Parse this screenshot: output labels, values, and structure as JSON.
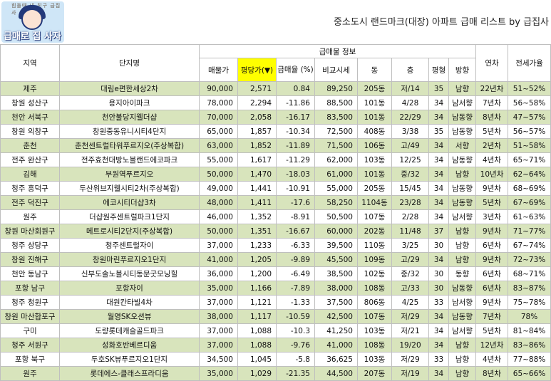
{
  "logo": {
    "arc_text": "힘들때 내 친구 급집사",
    "word": "급매로 집 사자"
  },
  "title": "중소도시 랜드마크(대장) 아파트 급매 리스트 by 급집사",
  "table": {
    "headers": {
      "region": "지역",
      "complex": "단지명",
      "group": "급매물 정보",
      "price": "매물가",
      "per_pyeong": "평당가(▼)",
      "discount": "급매율 (%)",
      "compare": "비교시세",
      "dong": "동",
      "floor": "층",
      "pyeong": "평형",
      "direction": "방향",
      "age": "연차",
      "jeonse": "전세가율"
    },
    "rows": [
      {
        "region": "제주",
        "complex": "대림e편한세상2차",
        "price": "90,000",
        "per": "2,571",
        "disc": "0.84",
        "cmp": "89,250",
        "dong": "205동",
        "floor": "저/14",
        "pyeong": "35",
        "dir": "남향",
        "age": "22년차",
        "jeonse": "51~52%"
      },
      {
        "region": "창원 성산구",
        "complex": "용지아이파크",
        "price": "78,000",
        "per": "2,294",
        "disc": "-11.86",
        "cmp": "88,500",
        "dong": "101동",
        "floor": "4/28",
        "pyeong": "34",
        "dir": "남서향",
        "age": "7년차",
        "jeonse": "56~58%"
      },
      {
        "region": "천안 서북구",
        "complex": "천안불당지웰더샵",
        "price": "70,000",
        "per": "2,058",
        "disc": "-16.17",
        "cmp": "83,500",
        "dong": "101동",
        "floor": "22/29",
        "pyeong": "34",
        "dir": "남동향",
        "age": "8년차",
        "jeonse": "47~57%"
      },
      {
        "region": "창원 의창구",
        "complex": "창원중동유니시티4단지",
        "price": "65,000",
        "per": "1,857",
        "disc": "-10.34",
        "cmp": "72,500",
        "dong": "408동",
        "floor": "3/38",
        "pyeong": "35",
        "dir": "남동향",
        "age": "5년차",
        "jeonse": "56~57%"
      },
      {
        "region": "춘천",
        "complex": "춘천센트럴타워푸르지오(주상복합)",
        "price": "63,000",
        "per": "1,852",
        "disc": "-11.89",
        "cmp": "71,500",
        "dong": "106동",
        "floor": "고/49",
        "pyeong": "34",
        "dir": "서향",
        "age": "2년차",
        "jeonse": "51~58%"
      },
      {
        "region": "전주 완산구",
        "complex": "전주효천대방노블랜드에코파크",
        "price": "55,000",
        "per": "1,617",
        "disc": "-11.29",
        "cmp": "62,000",
        "dong": "103동",
        "floor": "12/25",
        "pyeong": "34",
        "dir": "남동향",
        "age": "4년차",
        "jeonse": "65~71%"
      },
      {
        "region": "김해",
        "complex": "부원역푸르지오",
        "price": "50,000",
        "per": "1,470",
        "disc": "-18.03",
        "cmp": "61,000",
        "dong": "101동",
        "floor": "중/32",
        "pyeong": "34",
        "dir": "남향",
        "age": "10년차",
        "jeonse": "62~64%"
      },
      {
        "region": "청주 흥덕구",
        "complex": "두산위브지웰시티2차(주상복합)",
        "price": "49,000",
        "per": "1,441",
        "disc": "-10.91",
        "cmp": "55,000",
        "dong": "205동",
        "floor": "15/45",
        "pyeong": "34",
        "dir": "남동향",
        "age": "9년차",
        "jeonse": "68~69%"
      },
      {
        "region": "전주 덕진구",
        "complex": "에코시티더샵3차",
        "price": "48,000",
        "per": "1,411",
        "disc": "-17.6",
        "cmp": "58,250",
        "dong": "1104동",
        "floor": "23/28",
        "pyeong": "34",
        "dir": "남동향",
        "age": "5년차",
        "jeonse": "67~69%"
      },
      {
        "region": "원주",
        "complex": "더샵원주센트럴파크1단지",
        "price": "46,000",
        "per": "1,352",
        "disc": "-8.91",
        "cmp": "50,500",
        "dong": "107동",
        "floor": "2/28",
        "pyeong": "34",
        "dir": "남서향",
        "age": "3년차",
        "jeonse": "61~63%"
      },
      {
        "region": "창원 마산회원구",
        "complex": "메트로시티2단지(주상복합)",
        "price": "50,000",
        "per": "1,351",
        "disc": "-16.67",
        "cmp": "60,000",
        "dong": "202동",
        "floor": "11/48",
        "pyeong": "37",
        "dir": "남향",
        "age": "9년차",
        "jeonse": "71~77%"
      },
      {
        "region": "청주 상당구",
        "complex": "청주센트럴자이",
        "price": "37,000",
        "per": "1,233",
        "disc": "-6.33",
        "cmp": "39,500",
        "dong": "110동",
        "floor": "3/25",
        "pyeong": "30",
        "dir": "남향",
        "age": "6년차",
        "jeonse": "67~74%"
      },
      {
        "region": "창원 진해구",
        "complex": "창원마린푸르지오1단지",
        "price": "41,000",
        "per": "1,205",
        "disc": "-9.89",
        "cmp": "45,500",
        "dong": "109동",
        "floor": "고/29",
        "pyeong": "34",
        "dir": "남향",
        "age": "9년차",
        "jeonse": "72~73%"
      },
      {
        "region": "천안 동남구",
        "complex": "신부도솔노블시티동문굿모닝힐",
        "price": "36,000",
        "per": "1,200",
        "disc": "-6.49",
        "cmp": "38,500",
        "dong": "102동",
        "floor": "중/32",
        "pyeong": "30",
        "dir": "동향",
        "age": "6년차",
        "jeonse": "68~71%"
      },
      {
        "region": "포항 남구",
        "complex": "포항자이",
        "price": "35,000",
        "per": "1,166",
        "disc": "-7.89",
        "cmp": "38,000",
        "dong": "108동",
        "floor": "고/33",
        "pyeong": "30",
        "dir": "남동향",
        "age": "6년차",
        "jeonse": "83~87%"
      },
      {
        "region": "청주 청원구",
        "complex": "대원칸타빌4차",
        "price": "37,000",
        "per": "1,121",
        "disc": "-1.33",
        "cmp": "37,500",
        "dong": "806동",
        "floor": "4/25",
        "pyeong": "33",
        "dir": "남서향",
        "age": "9년차",
        "jeonse": "75~78%"
      },
      {
        "region": "창원 마산합포구",
        "complex": "월영SK오션뷰",
        "price": "38,000",
        "per": "1,117",
        "disc": "-10.59",
        "cmp": "42,500",
        "dong": "107동",
        "floor": "저/29",
        "pyeong": "34",
        "dir": "남동향",
        "age": "7년차",
        "jeonse": "78%"
      },
      {
        "region": "구미",
        "complex": "도량롯데캐슬골드파크",
        "price": "37,000",
        "per": "1,088",
        "disc": "-10.3",
        "cmp": "41,250",
        "dong": "103동",
        "floor": "저/21",
        "pyeong": "34",
        "dir": "남서향",
        "age": "5년차",
        "jeonse": "81~84%"
      },
      {
        "region": "청주 서원구",
        "complex": "성화호반베르디움",
        "price": "37,000",
        "per": "1,088",
        "disc": "-9.76",
        "cmp": "41,000",
        "dong": "108동",
        "floor": "19/20",
        "pyeong": "34",
        "dir": "남향",
        "age": "12년차",
        "jeonse": "83~86%"
      },
      {
        "region": "포항 북구",
        "complex": "두호SK뷰푸르지오1단지",
        "price": "34,500",
        "per": "1,045",
        "disc": "-5.8",
        "cmp": "36,625",
        "dong": "103동",
        "floor": "저/29",
        "pyeong": "33",
        "dir": "남향",
        "age": "4년차",
        "jeonse": "77~88%"
      },
      {
        "region": "원주",
        "complex": "롯데에스-클래스프라디움",
        "price": "35,000",
        "per": "1,029",
        "disc": "-21.35",
        "cmp": "44,500",
        "dong": "207동",
        "floor": "저/19",
        "pyeong": "34",
        "dir": "남향",
        "age": "8년차",
        "jeonse": "65~66%"
      }
    ]
  }
}
